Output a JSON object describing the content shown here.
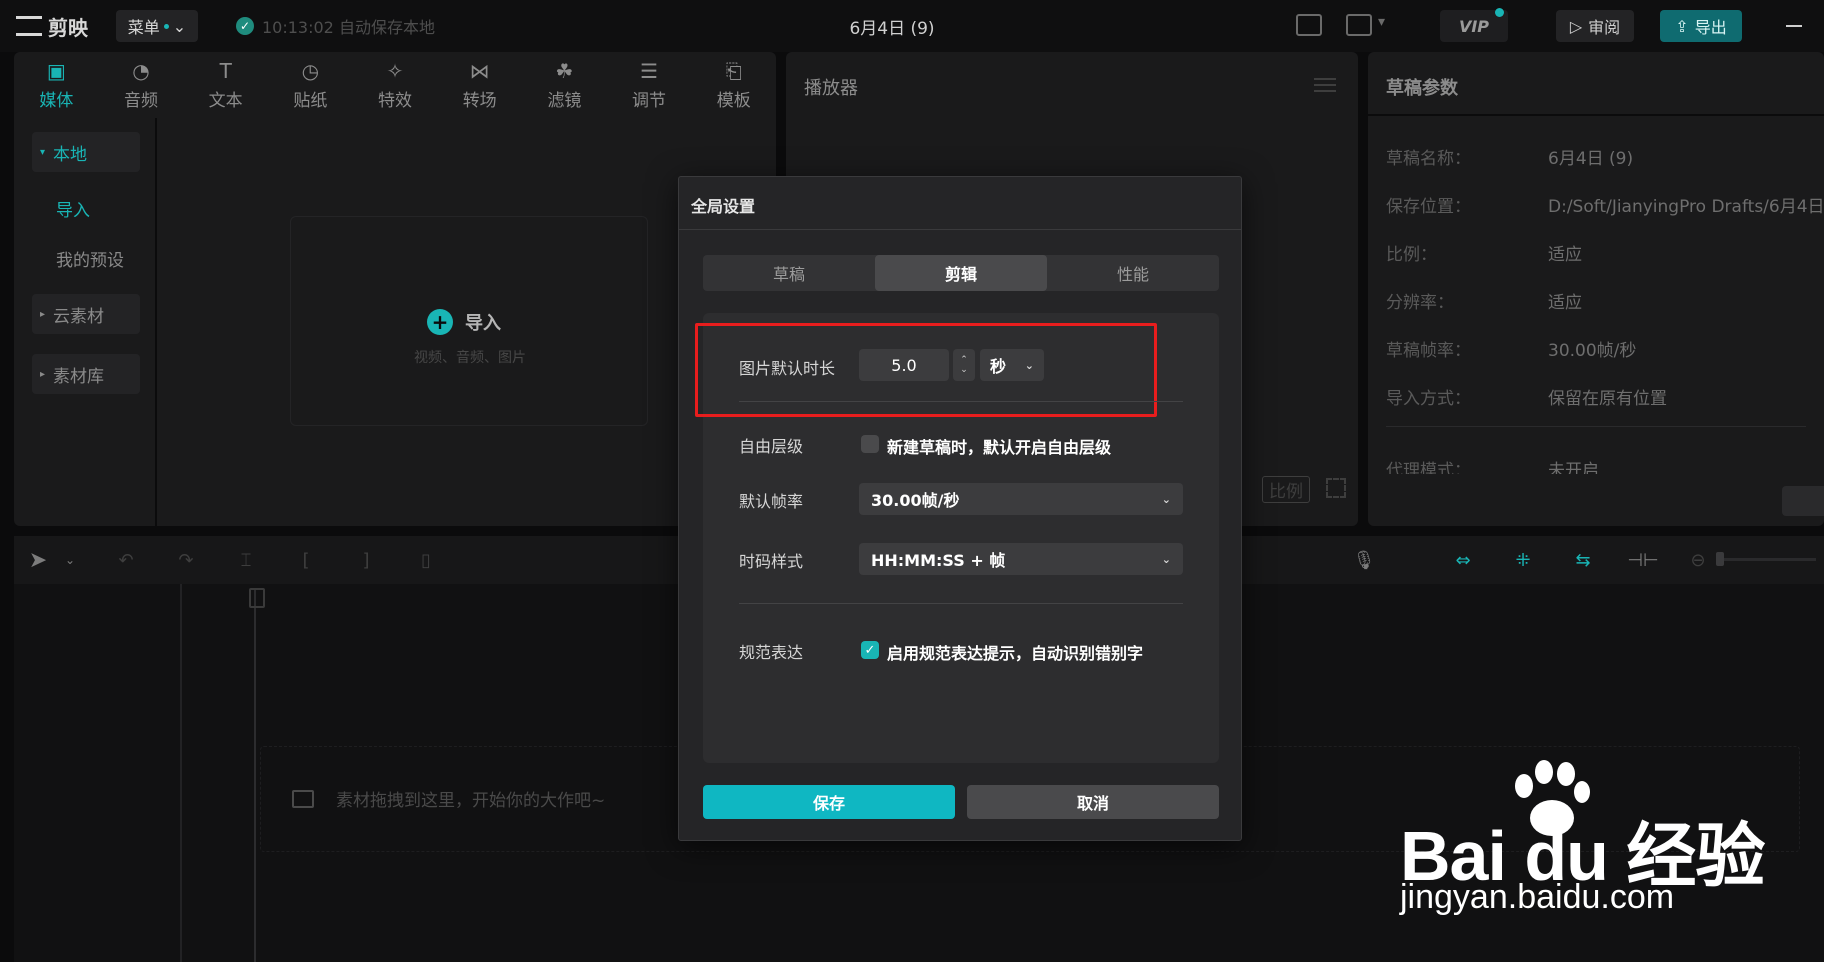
{
  "app": {
    "logo_text": "剪映",
    "menu_label": "菜单",
    "autosave_text": "10:13:02 自动保存本地",
    "project_title": "6月4日 (9)",
    "vip_label": "VIP",
    "review_label": "审阅",
    "export_label": "导出"
  },
  "media": {
    "tabs": [
      {
        "label": "媒体",
        "icon": "media-icon"
      },
      {
        "label": "音频",
        "icon": "audio-icon"
      },
      {
        "label": "文本",
        "icon": "text-icon"
      },
      {
        "label": "贴纸",
        "icon": "sticker-icon"
      },
      {
        "label": "特效",
        "icon": "effects-icon"
      },
      {
        "label": "转场",
        "icon": "transition-icon"
      },
      {
        "label": "滤镜",
        "icon": "filter-icon"
      },
      {
        "label": "调节",
        "icon": "adjust-icon"
      },
      {
        "label": "模板",
        "icon": "template-icon"
      }
    ],
    "sidebar": {
      "local": "本地",
      "import": "导入",
      "my_presets": "我的预设",
      "cloud": "云素材",
      "library": "素材库"
    },
    "import_label": "导入",
    "import_hint": "视频、音频、图片"
  },
  "player": {
    "title": "播放器",
    "ratio_label": "比例"
  },
  "params": {
    "title": "草稿参数",
    "rows": [
      {
        "k": "草稿名称：",
        "v": "6月4日 (9)"
      },
      {
        "k": "保存位置：",
        "v": "D:/Soft/JianyingPro Drafts/6月4日"
      },
      {
        "k": "比例：",
        "v": "适应"
      },
      {
        "k": "分辨率：",
        "v": "适应"
      },
      {
        "k": "草稿帧率：",
        "v": "30.00帧/秒"
      },
      {
        "k": "导入方式：",
        "v": "保留在原有位置"
      },
      {
        "k": "代理模式：",
        "v": "未开启"
      }
    ]
  },
  "timeline": {
    "drop_hint": "素材拖拽到这里，开始你的大作吧~"
  },
  "dialog": {
    "title": "全局设置",
    "tabs": [
      "草稿",
      "剪辑",
      "性能"
    ],
    "active_tab": "剪辑",
    "image_duration": {
      "label": "图片默认时长",
      "value": "5.0",
      "unit": "秒"
    },
    "free_layer": {
      "label": "自由层级",
      "checkbox_label": "新建草稿时，默认开启自由层级",
      "checked": false
    },
    "frame_rate": {
      "label": "默认帧率",
      "value": "30.00帧/秒"
    },
    "timecode": {
      "label": "时码样式",
      "value": "HH:MM:SS + 帧"
    },
    "standard": {
      "label": "规范表达",
      "checkbox_label": "启用规范表达提示，自动识别错别字",
      "checked": true
    },
    "save_label": "保存",
    "cancel_label": "取消"
  },
  "watermark": {
    "brand": "Bai du 经验",
    "url": "jingyan.baidu.com"
  },
  "colors": {
    "accent": "#19b5b5",
    "highlight": "#e81d1d",
    "save_button": "#0fb7c2"
  }
}
